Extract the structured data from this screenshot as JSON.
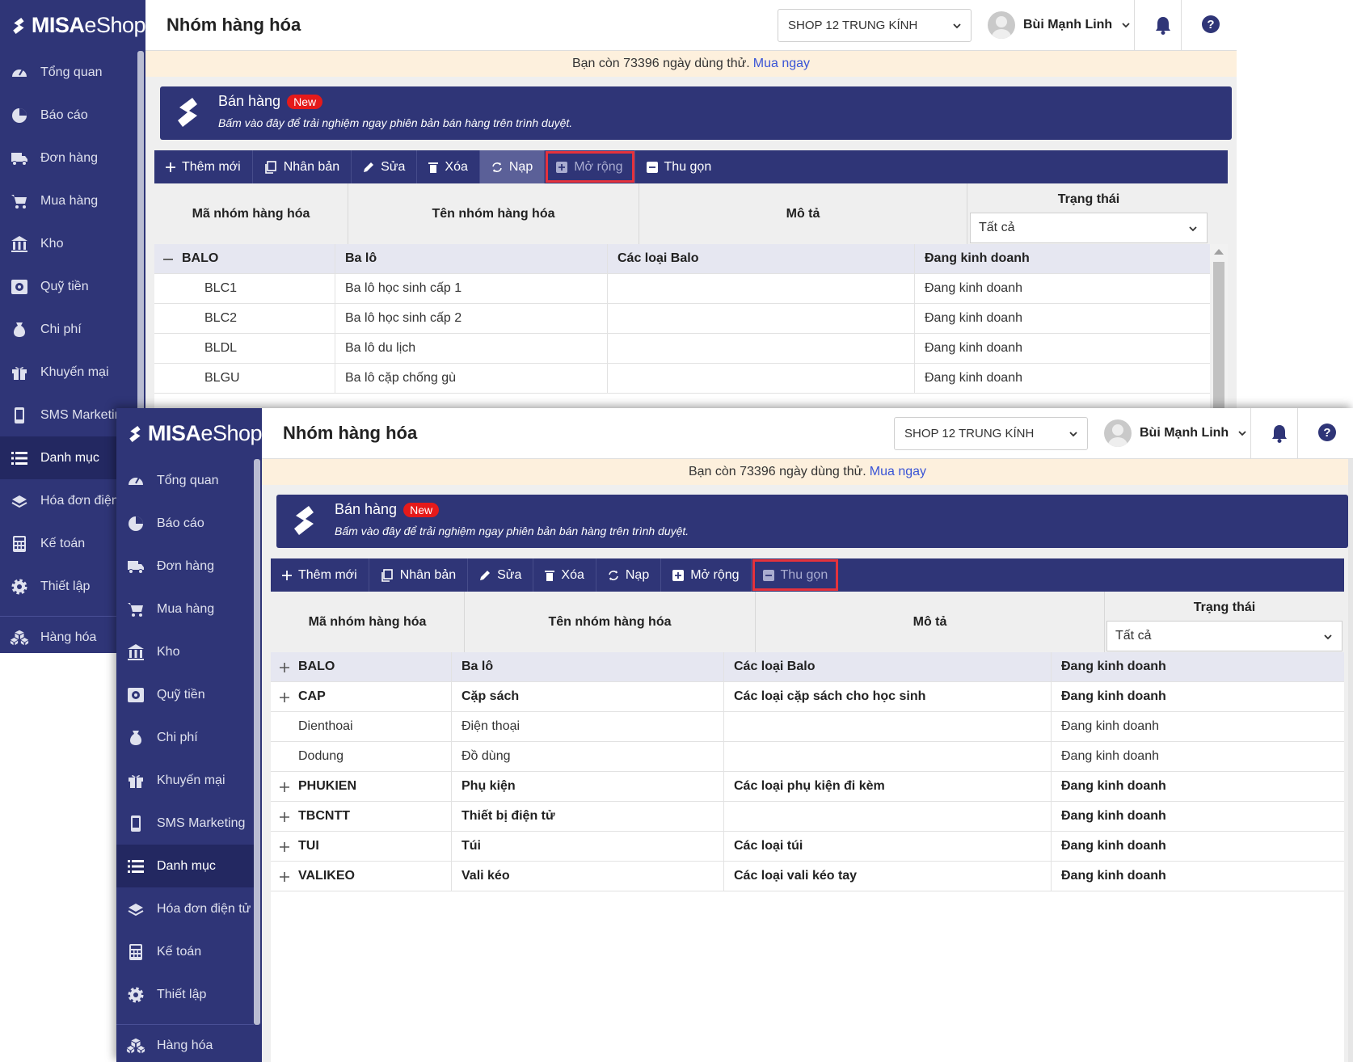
{
  "brand": {
    "logo_bold": "MISA",
    "logo_light": "eShop"
  },
  "sidebar": {
    "items": [
      {
        "label": "Tổng quan",
        "icon": "dashboard-icon"
      },
      {
        "label": "Báo cáo",
        "icon": "pie-chart-icon"
      },
      {
        "label": "Đơn hàng",
        "icon": "truck-icon"
      },
      {
        "label": "Mua hàng",
        "icon": "cart-icon"
      },
      {
        "label": "Kho",
        "icon": "warehouse-icon"
      },
      {
        "label": "Quỹ tiền",
        "icon": "safe-icon"
      },
      {
        "label": "Chi phí",
        "icon": "money-bag-icon"
      },
      {
        "label": "Khuyến mại",
        "icon": "gift-icon"
      },
      {
        "label": "SMS Marketing",
        "icon": "phone-icon"
      },
      {
        "label": "Danh mục",
        "icon": "list-icon"
      },
      {
        "label": "Hóa đơn điện tử",
        "icon": "invoice-icon"
      },
      {
        "label": "Kế toán",
        "icon": "calculator-icon"
      },
      {
        "label": "Thiết lập",
        "icon": "gear-icon"
      },
      {
        "label": "Hàng hóa",
        "icon": "boxes-icon"
      }
    ]
  },
  "header": {
    "title": "Nhóm hàng hóa",
    "shop": "SHOP 12 TRUNG KÍNH",
    "user": "Bùi Mạnh Linh"
  },
  "notice": {
    "text": "Bạn còn 73396 ngày dùng thử.",
    "link": "Mua ngay"
  },
  "banner": {
    "title": "Bán hàng",
    "badge": "New",
    "subtitle": "Bấm vào đây để trải nghiệm ngay phiên bản bán hàng trên trình duyệt."
  },
  "toolbar": {
    "add": "Thêm mới",
    "duplicate": "Nhân bản",
    "edit": "Sửa",
    "delete": "Xóa",
    "reload": "Nạp",
    "expand": "Mở rộng",
    "collapse": "Thu gọn"
  },
  "grid": {
    "columns": [
      "Mã nhóm hàng hóa",
      "Tên nhóm hàng hóa",
      "Mô tả",
      "Trạng thái"
    ],
    "status_filter": "Tất cả"
  },
  "shot1": {
    "rows": [
      {
        "code": "BALO",
        "name": "Ba lô",
        "desc": "Các loại Balo",
        "status": "Đang kinh doanh",
        "group": true,
        "toggle": "minus"
      },
      {
        "code": "BLC1",
        "name": "Ba lô học sinh cấp 1",
        "desc": "",
        "status": "Đang kinh doanh",
        "group": false,
        "child": true
      },
      {
        "code": "BLC2",
        "name": "Ba lô học sinh cấp 2",
        "desc": "",
        "status": "Đang kinh doanh",
        "group": false,
        "child": true
      },
      {
        "code": "BLDL",
        "name": "Ba lô du lịch",
        "desc": "",
        "status": "Đang kinh doanh",
        "group": false,
        "child": true
      },
      {
        "code": "BLGU",
        "name": "Ba lô cặp chống gù",
        "desc": "",
        "status": "Đang kinh doanh",
        "group": false,
        "child": true
      }
    ]
  },
  "shot2": {
    "rows": [
      {
        "code": "BALO",
        "name": "Ba lô",
        "desc": "Các loại Balo",
        "status": "Đang kinh doanh",
        "group": true,
        "toggle": "plus"
      },
      {
        "code": "CAP",
        "name": "Cặp sách",
        "desc": "Các loại cặp sách cho học sinh",
        "status": "Đang kinh doanh",
        "group": true,
        "toggle": "plus"
      },
      {
        "code": "Dienthoai",
        "name": "Điện thoại",
        "desc": "",
        "status": "Đang kinh doanh",
        "group": false
      },
      {
        "code": "Dodung",
        "name": "Đồ dùng",
        "desc": "",
        "status": "Đang kinh doanh",
        "group": false
      },
      {
        "code": "PHUKIEN",
        "name": "Phụ kiện",
        "desc": "Các loại phụ kiện đi kèm",
        "status": "Đang kinh doanh",
        "group": true,
        "toggle": "plus"
      },
      {
        "code": "TBCNTT",
        "name": "Thiết bị điện tử",
        "desc": "",
        "status": "Đang kinh doanh",
        "group": true,
        "toggle": "plus"
      },
      {
        "code": "TUI",
        "name": "Túi",
        "desc": "Các loại túi",
        "status": "Đang kinh doanh",
        "group": true,
        "toggle": "plus"
      },
      {
        "code": "VALIKEO",
        "name": "Vali kéo",
        "desc": "Các loại vali kéo tay",
        "status": "Đang kinh doanh",
        "group": true,
        "toggle": "plus"
      }
    ]
  },
  "colors": {
    "sidebar": "#2f3577",
    "highlight": "#e5323c",
    "notice_bg": "#fdf0dd",
    "new_badge": "#e51a1a"
  }
}
